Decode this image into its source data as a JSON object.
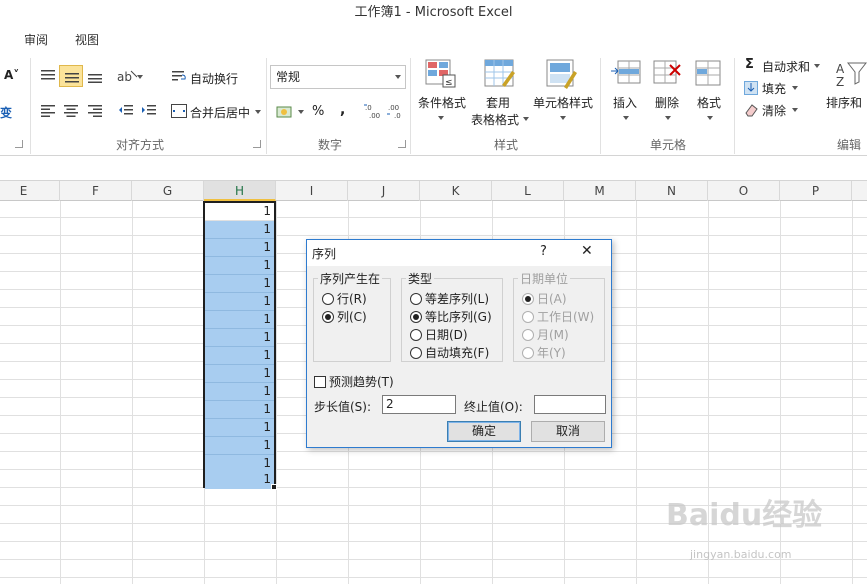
{
  "window": {
    "title": "工作簿1  -  Microsoft Excel"
  },
  "ribbon_tabs": [
    "审阅",
    "视图"
  ],
  "ribbon": {
    "alignment": {
      "wrap_text": "自动换行",
      "merge_center": "合并后居中",
      "group_label": "对齐方式"
    },
    "number": {
      "format_value": "常规",
      "percent": "%",
      "comma": ",",
      "group_label": "数字"
    },
    "styles": {
      "conditional_format": "条件格式",
      "format_table_1": "套用",
      "format_table_2": "表格格式",
      "cell_styles": "单元格样式",
      "group_label": "样式"
    },
    "cells": {
      "insert": "插入",
      "delete": "删除",
      "format": "格式",
      "group_label": "单元格"
    },
    "editing": {
      "autosum": "自动求和",
      "fill": "填充",
      "clear": "清除",
      "sort_filter": "排序和",
      "group_label": "编辑"
    }
  },
  "columns": [
    "E",
    "F",
    "G",
    "H",
    "I",
    "J",
    "K",
    "L",
    "M",
    "N",
    "O",
    "P"
  ],
  "selected_column": "H",
  "cells_h": [
    "1",
    "1",
    "1",
    "1",
    "1",
    "1",
    "1",
    "1",
    "1",
    "1",
    "1",
    "1",
    "1",
    "1",
    "1",
    "1"
  ],
  "dialog": {
    "title": "序列",
    "help": "?",
    "close": "✕",
    "series_in": {
      "legend": "序列产生在",
      "options": [
        {
          "label": "行(R)",
          "checked": false
        },
        {
          "label": "列(C)",
          "checked": true
        }
      ]
    },
    "type": {
      "legend": "类型",
      "options": [
        {
          "label": "等差序列(L)",
          "checked": false
        },
        {
          "label": "等比序列(G)",
          "checked": true
        },
        {
          "label": "日期(D)",
          "checked": false
        },
        {
          "label": "自动填充(F)",
          "checked": false
        }
      ]
    },
    "date_unit": {
      "legend": "日期单位",
      "options": [
        {
          "label": "日(A)",
          "checked": true
        },
        {
          "label": "工作日(W)",
          "checked": false
        },
        {
          "label": "月(M)",
          "checked": false
        },
        {
          "label": "年(Y)",
          "checked": false
        }
      ]
    },
    "trend": {
      "label": "预测趋势(T)",
      "checked": false
    },
    "step": {
      "label": "步长值(S):",
      "value": "2"
    },
    "stop": {
      "label": "终止值(O):",
      "value": ""
    },
    "ok": "确定",
    "cancel": "取消"
  },
  "watermark": {
    "main": "Baidu经验",
    "sub": "jingyan.baidu.com"
  }
}
